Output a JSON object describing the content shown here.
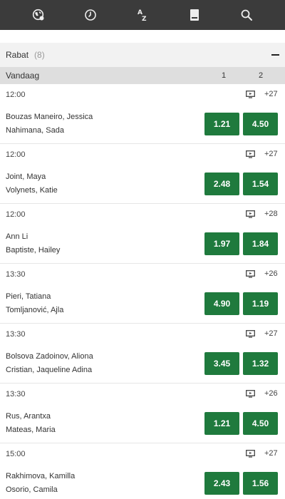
{
  "icons": {
    "nav": [
      "globe-icon",
      "clock-icon",
      "az-sort-icon",
      "betslip-icon",
      "search-icon"
    ],
    "row": "tv-icon"
  },
  "colors": {
    "topbar": "#3b3b3b",
    "odds_button": "#1f7a3d",
    "league_header": "#f2f2f2",
    "column_header": "#dedede"
  },
  "league": {
    "name": "Rabat",
    "count": "(8)"
  },
  "columns": {
    "day": "Vandaag",
    "col1": "1",
    "col2": "2"
  },
  "events": [
    {
      "time": "12:00",
      "more": "+27",
      "player1": "Bouzas Maneiro, Jessica",
      "player2": "Nahimana, Sada",
      "odd1": "1.21",
      "odd2": "4.50"
    },
    {
      "time": "12:00",
      "more": "+27",
      "player1": "Joint, Maya",
      "player2": "Volynets, Katie",
      "odd1": "2.48",
      "odd2": "1.54"
    },
    {
      "time": "12:00",
      "more": "+28",
      "player1": "Ann Li",
      "player2": "Baptiste, Hailey",
      "odd1": "1.97",
      "odd2": "1.84"
    },
    {
      "time": "13:30",
      "more": "+26",
      "player1": "Pieri, Tatiana",
      "player2": "Tomljanović, Ajla",
      "odd1": "4.90",
      "odd2": "1.19"
    },
    {
      "time": "13:30",
      "more": "+27",
      "player1": "Bolsova Zadoinov, Aliona",
      "player2": "Cristian, Jaqueline Adina",
      "odd1": "3.45",
      "odd2": "1.32"
    },
    {
      "time": "13:30",
      "more": "+26",
      "player1": "Rus, Arantxa",
      "player2": "Mateas, Maria",
      "odd1": "1.21",
      "odd2": "4.50"
    },
    {
      "time": "15:00",
      "more": "+27",
      "player1": "Rakhimova, Kamilla",
      "player2": "Osorio, Camila",
      "odd1": "2.43",
      "odd2": "1.56"
    }
  ]
}
